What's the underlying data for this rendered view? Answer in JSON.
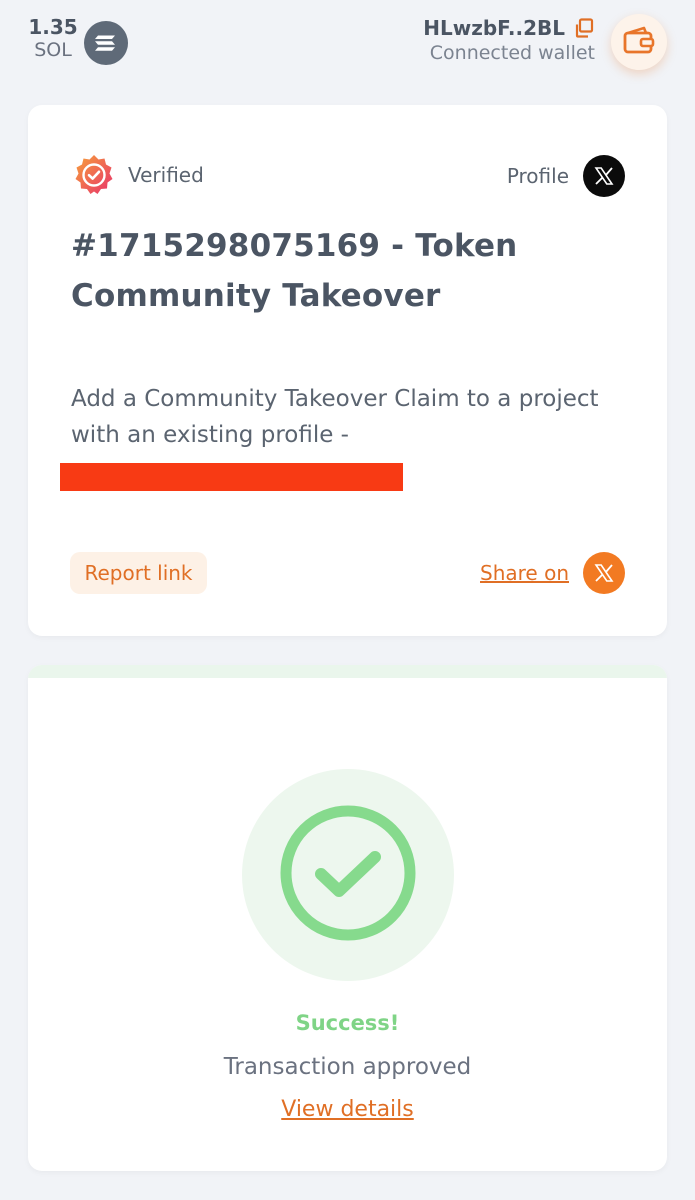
{
  "header": {
    "balance_amount": "1.35",
    "balance_unit": "SOL",
    "wallet_address": "HLwzbF..2BL",
    "wallet_status": "Connected wallet"
  },
  "claim": {
    "verified_label": "Verified",
    "profile_label": "Profile",
    "title": "#1715298075169 - Token Community Takeover",
    "description": "Add a Community Takeover Claim to a project with an existing profile -",
    "report_label": "Report link",
    "share_label": "Share on"
  },
  "status": {
    "title": "Success!",
    "subtitle": "Transaction approved",
    "details_label": "View details"
  },
  "icons": {
    "sol": "solana-icon",
    "copy": "copy-icon",
    "wallet": "wallet-icon",
    "verified": "verified-badge-icon",
    "x": "x-logo-icon",
    "success": "checkmark-circle-icon"
  },
  "colors": {
    "accent_orange": "#e06f25",
    "success_green": "#7fd486",
    "redaction_red": "#f83a14",
    "background": "#f1f3f7"
  }
}
